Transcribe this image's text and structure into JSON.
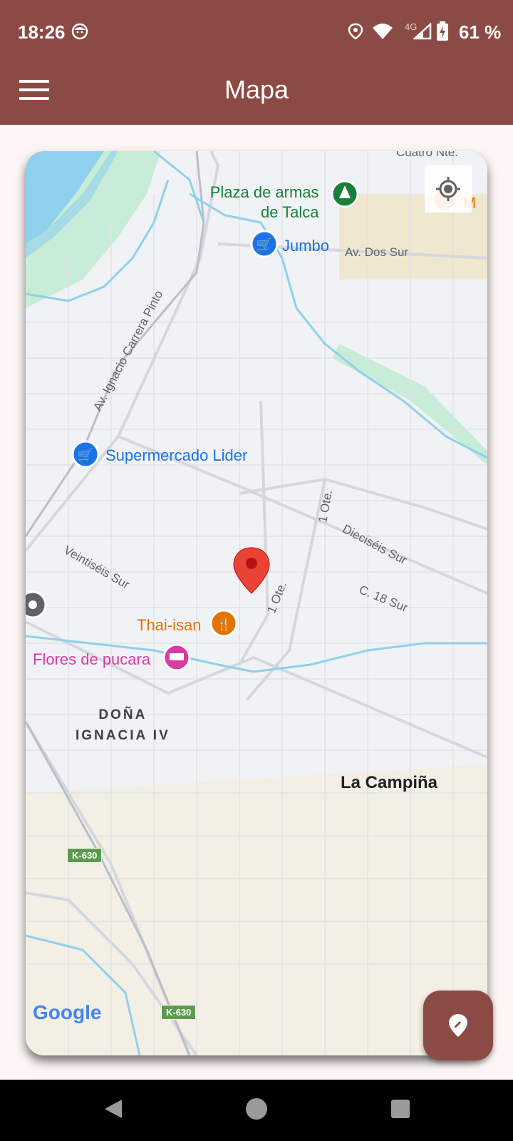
{
  "status_bar": {
    "time": "18:26",
    "network": "4G",
    "battery_percent": "61 %"
  },
  "app_bar": {
    "title": "Mapa",
    "menu_icon": "hamburger-menu-icon"
  },
  "map": {
    "poi": {
      "plaza_line1": "Plaza de armas",
      "plaza_line2": "de Talca",
      "jumbo": "Jumbo",
      "lider": "Supermercado Lider",
      "thai": "Thai-isan",
      "flores": "Flores de pucara",
      "partial_m": "M"
    },
    "streets": {
      "cuatro_nte": "Cuatro Nte.",
      "dos_sur": "Av. Dos Sur",
      "carrera_pinto": "Av. Ignacio Carrera Pinto",
      "uno_ote_a": "1 Ote.",
      "uno_ote_b": "1 Ote.",
      "dieciseis": "Dieciséis Sur",
      "c18": "C. 18 Sur",
      "veintiseis": "Veintiséis Sur"
    },
    "areas": {
      "dona_line1": "DOÑA",
      "dona_line2": "IGNACIA IV",
      "campina": "La Campiña"
    },
    "road_badges": {
      "k630_a": "K-630",
      "k630_b": "K-630"
    },
    "attribution": "Google",
    "colors": {
      "water": "#8fd0ec",
      "park": "#c7ecd7",
      "urban": "#f1f2f5",
      "outskirts": "#f3efe4",
      "marker": "#ea4335"
    }
  },
  "fab": {
    "icon": "edit-location-icon"
  },
  "nav_bar": {
    "back": "back-icon",
    "home": "home-icon",
    "recents": "recents-icon"
  },
  "theme": {
    "primary": "#8c4a44",
    "background": "#fdf6f4"
  }
}
